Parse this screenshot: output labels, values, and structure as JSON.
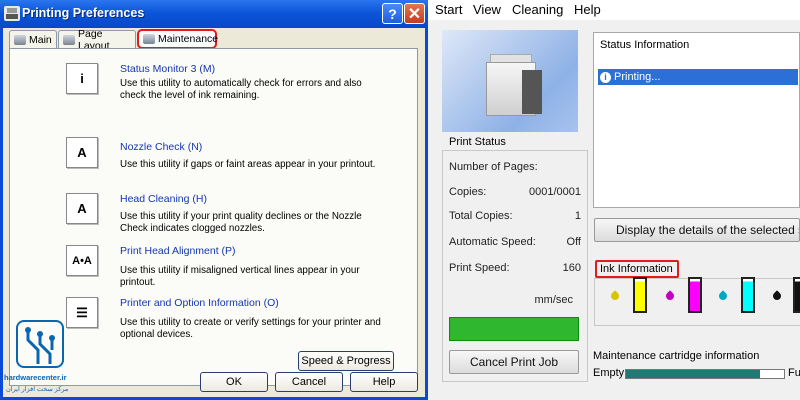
{
  "dialog": {
    "title": "Printing Preferences",
    "help_label": "?",
    "close_label": "✕",
    "tabs": [
      {
        "label": "Main"
      },
      {
        "label": "Page Layout"
      },
      {
        "label": "Maintenance"
      }
    ],
    "utilities": [
      {
        "title": "Status Monitor 3 (M)",
        "icon_text": "i",
        "desc": "Use this utility to automatically check for errors and also check the level of ink remaining."
      },
      {
        "title": "Nozzle Check (N)",
        "icon_text": "A",
        "desc": "Use this utility if gaps or faint areas appear in your printout."
      },
      {
        "title": "Head Cleaning (H)",
        "icon_text": "A",
        "desc": "Use this utility if your print quality declines or the Nozzle Check indicates clogged nozzles."
      },
      {
        "title": "Print Head Alignment (P)",
        "icon_text": "A•A",
        "desc": "Use this utility if misaligned vertical lines appear in your printout."
      },
      {
        "title": "Printer and Option Information (O)",
        "icon_text": "☰",
        "desc": "Use this utility to create or verify settings for your printer and optional devices."
      }
    ],
    "speed_button": "Speed & Progress",
    "ok_button": "OK",
    "cancel_button": "Cancel",
    "help_button": "Help"
  },
  "app": {
    "menu": [
      "Start",
      "View",
      "Cleaning",
      "Help"
    ],
    "print_status": {
      "title": "Print Status",
      "rows": [
        {
          "label": "Number of Pages:",
          "value": ""
        },
        {
          "label": "Copies:",
          "value": "0001/0001"
        },
        {
          "label": "Total Copies:",
          "value": "1"
        },
        {
          "label": "Automatic Speed:",
          "value": "Off"
        },
        {
          "label": "Print Speed:",
          "value": "160"
        }
      ],
      "speed_unit": "mm/sec",
      "cancel_button": "Cancel Print Job"
    },
    "status_info": {
      "header": "Status Information",
      "item": "Printing..."
    },
    "details_button": "Display the details of the selected status",
    "ink_information": "Ink Information",
    "maintenance": {
      "label": "Maintenance cartridge information",
      "empty": "Empty",
      "full": "Full",
      "level": 0.85
    }
  },
  "watermark": {
    "site": "hardwarecenter.ir",
    "subtitle": "مرکز سخت افزار ایران"
  },
  "colors": {
    "accent_red": "#e21b1b",
    "xp_blue": "#0a4ad8",
    "progress_green": "#2fb82f",
    "link_blue": "#1436b4"
  }
}
